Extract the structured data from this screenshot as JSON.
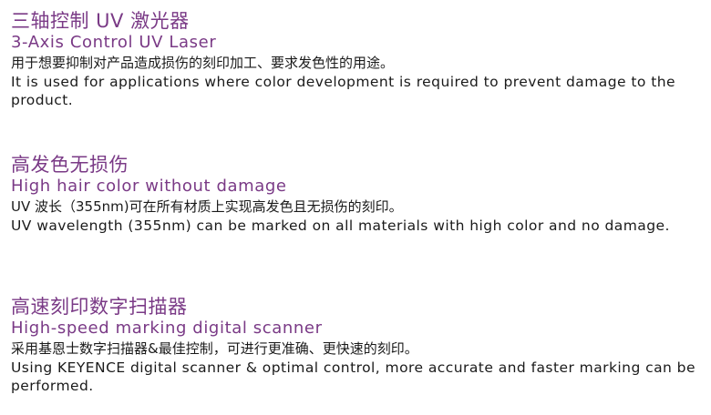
{
  "sections": [
    {
      "title_zh": "三轴控制 UV 激光器",
      "title_en": "3-Axis Control UV Laser",
      "desc_zh": "用于想要抑制对产品造成损伤的刻印加工、要求发色性的用途。",
      "desc_en": "It is used for applications where color development is required to prevent damage to the product."
    },
    {
      "title_zh": "高发色无损伤",
      "title_en": "High hair color without damage",
      "desc_zh": "UV 波长（355nm)可在所有材质上实现高发色且无损伤的刻印。",
      "desc_en": "UV wavelength (355nm) can be marked on all materials with high color and no damage."
    },
    {
      "title_zh": "高速刻印数字扫描器",
      "title_en": "High-speed marking digital scanner",
      "desc_zh": "采用基恩士数字扫描器&最佳控制，可进行更准确、更快速的刻印。",
      "desc_en": "Using KEYENCE digital scanner & optimal control, more accurate and faster marking can be performed."
    }
  ],
  "colors": {
    "heading": "#7a3a86",
    "body_text": "#1a1a1a",
    "background": "#ffffff"
  }
}
